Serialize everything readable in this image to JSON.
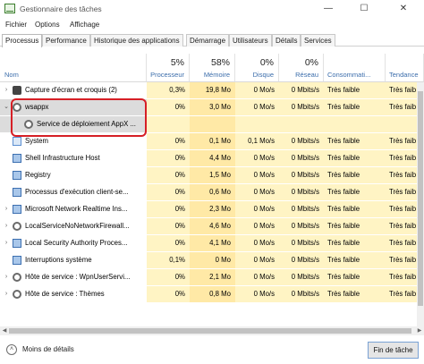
{
  "window": {
    "title": "Gestionnaire des tâches",
    "minimize": "—",
    "maximize": "☐",
    "close": "✕"
  },
  "menu": [
    "Fichier",
    "Options",
    "Affichage"
  ],
  "tabs": [
    "Processus",
    "Performance",
    "Historique des applications",
    "Démarrage",
    "Utilisateurs",
    "Détails",
    "Services"
  ],
  "active_tab": "Processus",
  "columns": {
    "name": {
      "label": "Nom"
    },
    "cpu": {
      "pct": "5%",
      "label": "Processeur"
    },
    "mem": {
      "pct": "58%",
      "label": "Mémoire"
    },
    "disk": {
      "pct": "0%",
      "label": "Disque"
    },
    "net": {
      "pct": "0%",
      "label": "Réseau"
    },
    "power": {
      "label": "Consommati..."
    },
    "trend": {
      "pct": "",
      "label": "Tendance"
    }
  },
  "rows": [
    {
      "name": "Capture d'écran et croquis (2)",
      "cpu": "0,3%",
      "mem": "19,8 Mo",
      "disk": "0 Mo/s",
      "net": "0 Mbits/s",
      "power": "Très faible",
      "trend": "Très faib",
      "icon": "capture-icon",
      "expander": "›"
    },
    {
      "name": "wsappx",
      "cpu": "0%",
      "mem": "3,0 Mo",
      "disk": "0 Mo/s",
      "net": "0 Mbits/s",
      "power": "Très faible",
      "trend": "Très faib",
      "icon": "gear-icon",
      "expander": "⌄"
    },
    {
      "name": "Service de déploiement AppX ...",
      "cpu": "",
      "mem": "",
      "disk": "",
      "net": "",
      "power": "",
      "trend": "",
      "icon": "gear-icon",
      "expander": ""
    },
    {
      "name": "System",
      "cpu": "0%",
      "mem": "0,1 Mo",
      "disk": "0,1 Mo/s",
      "net": "0 Mbits/s",
      "power": "Très faible",
      "trend": "Très faib",
      "icon": "system-icon",
      "expander": ""
    },
    {
      "name": "Shell Infrastructure Host",
      "cpu": "0%",
      "mem": "4,4 Mo",
      "disk": "0 Mo/s",
      "net": "0 Mbits/s",
      "power": "Très faible",
      "trend": "Très faib",
      "icon": "window-icon",
      "expander": ""
    },
    {
      "name": "Registry",
      "cpu": "0%",
      "mem": "1,5 Mo",
      "disk": "0 Mo/s",
      "net": "0 Mbits/s",
      "power": "Très faible",
      "trend": "Très faib",
      "icon": "window-icon",
      "expander": ""
    },
    {
      "name": "Processus d'exécution client-se...",
      "cpu": "0%",
      "mem": "0,6 Mo",
      "disk": "0 Mo/s",
      "net": "0 Mbits/s",
      "power": "Très faible",
      "trend": "Très faib",
      "icon": "window-icon",
      "expander": ""
    },
    {
      "name": "Microsoft Network Realtime Ins...",
      "cpu": "0%",
      "mem": "2,3 Mo",
      "disk": "0 Mo/s",
      "net": "0 Mbits/s",
      "power": "Très faible",
      "trend": "Très faib",
      "icon": "window-icon",
      "expander": "›"
    },
    {
      "name": "LocalServiceNoNetworkFirewall...",
      "cpu": "0%",
      "mem": "4,6 Mo",
      "disk": "0 Mo/s",
      "net": "0 Mbits/s",
      "power": "Très faible",
      "trend": "Très faib",
      "icon": "gear-icon",
      "expander": "›"
    },
    {
      "name": "Local Security Authority Proces...",
      "cpu": "0%",
      "mem": "4,1 Mo",
      "disk": "0 Mo/s",
      "net": "0 Mbits/s",
      "power": "Très faible",
      "trend": "Très faib",
      "icon": "window-icon",
      "expander": "›"
    },
    {
      "name": "Interruptions système",
      "cpu": "0,1%",
      "mem": "0 Mo",
      "disk": "0 Mo/s",
      "net": "0 Mbits/s",
      "power": "Très faible",
      "trend": "Très faib",
      "icon": "window-icon",
      "expander": ""
    },
    {
      "name": "Hôte de service : WpnUserServi...",
      "cpu": "0%",
      "mem": "2,1 Mo",
      "disk": "0 Mo/s",
      "net": "0 Mbits/s",
      "power": "Très faible",
      "trend": "Très faib",
      "icon": "gear-icon",
      "expander": "›"
    },
    {
      "name": "Hôte de service : Thèmes",
      "cpu": "0%",
      "mem": "0,8 Mo",
      "disk": "0 Mo/s",
      "net": "0 Mbits/s",
      "power": "Très faible",
      "trend": "Très faib",
      "icon": "gear-icon",
      "expander": "›"
    }
  ],
  "footer": {
    "less_details": "Moins de détails",
    "end_task": "Fin de tâche"
  },
  "colors": {
    "highlight_box": "#d61f26",
    "cell_light": "#fff4c4",
    "cell_dark": "#ffe9a6",
    "header_label": "#3b6dab"
  }
}
